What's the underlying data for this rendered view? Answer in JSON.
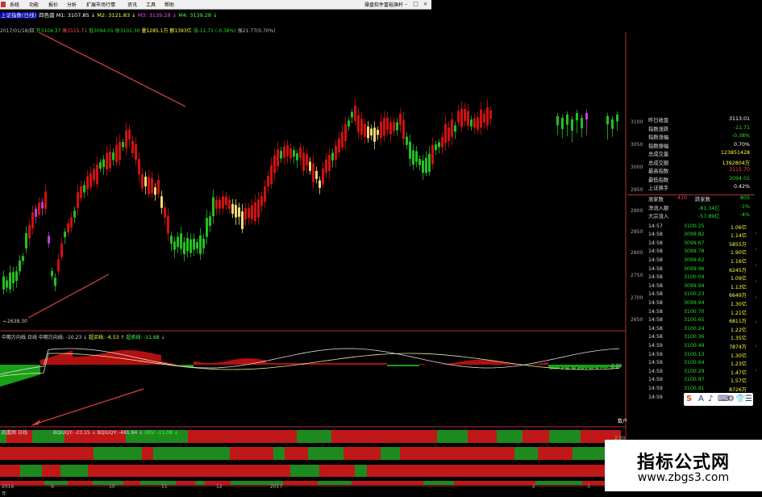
{
  "menubar": {
    "items": [
      "系统",
      "功能",
      "报价",
      "分析",
      "扩展市场行情",
      "资讯",
      "工具",
      "帮助"
    ],
    "right_title": "操盘软件富裕旗杆"
  },
  "chart_header": {
    "title": "上证指数(日线)",
    "mode": "四色谱",
    "m1": "M1: 3107.85 ↓",
    "m2": "M2: 3121.83 ↓",
    "m3": "M3: 3139.28 ↓",
    "m4": "M4: 3139.28 ↓"
  },
  "ohlc_line": {
    "date": "2017/01/18/四",
    "open": "开3104.37",
    "high": "高3115.71",
    "low": "低3094.01",
    "close": "收3101.30",
    "volume": "量1285.1万",
    "amount": "额1393亿",
    "change": "涨-11.71",
    "change_pct": "(-0.38%)",
    "amplitude": "振21.77(0.70%)"
  },
  "price_axis": {
    "ticks": [
      "3100",
      "3050",
      "3000",
      "2950",
      "2900",
      "2850",
      "2800",
      "2750",
      "2700",
      "2650"
    ],
    "low_marker": "←2638.30",
    "colors": {
      "up": "#d01010",
      "down": "#22c022",
      "warm": "#f0d878",
      "special": "#c040d0"
    }
  },
  "info_panel": {
    "rows": [
      {
        "label": "昨日收盘",
        "value": "3113.01",
        "color": "#ffffff"
      },
      {
        "label": "指数涨跌",
        "value": "-11.71",
        "color": "#22e022"
      },
      {
        "label": "指数涨幅",
        "value": "-0.38%",
        "color": "#22e022"
      },
      {
        "label": "指数振幅",
        "value": "0.70%",
        "color": "#ffffff"
      },
      {
        "label": "总成交量",
        "value": "123851428",
        "color": "#ffff44"
      },
      {
        "label": "总成交额",
        "value": "1392804万",
        "color": "#ffff44"
      },
      {
        "label": "最高指数",
        "value": "3115.70",
        "color": "#ff4040"
      },
      {
        "label": "最低指数",
        "value": "3094.01",
        "color": "#22e022"
      },
      {
        "label": "上证换手",
        "value": "0.42%",
        "color": "#ffffff"
      }
    ],
    "rise_fall": {
      "rise_label": "涨家数",
      "rise": "410",
      "fall_label": "跌家数",
      "fall": "805"
    },
    "flows": [
      {
        "label": "净流入额",
        "value": "-81.34亿",
        "pct": "-1%"
      },
      {
        "label": "大宗流入",
        "value": "-57.89亿",
        "pct": "-4%"
      }
    ],
    "ticks": [
      {
        "time": "14:57",
        "price": "3100.25",
        "vol": "1.06亿"
      },
      {
        "time": "14:58",
        "price": "3099.82",
        "vol": "1.14亿"
      },
      {
        "time": "14:58",
        "price": "3099.67",
        "vol": "5855万"
      },
      {
        "time": "14:58",
        "price": "3099.78",
        "vol": "1.90亿"
      },
      {
        "time": "14:58",
        "price": "3099.62",
        "vol": "1.16亿"
      },
      {
        "time": "14:58",
        "price": "3099.96",
        "vol": "6245万"
      },
      {
        "time": "14:58",
        "price": "3100.04",
        "vol": "1.09亿"
      },
      {
        "time": "14:58",
        "price": "3099.94",
        "vol": "1.13亿"
      },
      {
        "time": "14:58",
        "price": "3100.23",
        "vol": "6649万"
      },
      {
        "time": "14:58",
        "price": "3099.94",
        "vol": "1.30亿"
      },
      {
        "time": "14:58",
        "price": "3100.70",
        "vol": "1.21亿"
      },
      {
        "time": "14:58",
        "price": "3100.65",
        "vol": "6811万"
      },
      {
        "time": "14:58",
        "price": "3100.24",
        "vol": "1.22亿"
      },
      {
        "time": "14:58",
        "price": "3100.36",
        "vol": "1.35亿"
      },
      {
        "time": "14:59",
        "price": "3100.49",
        "vol": "7874万"
      },
      {
        "time": "14:59",
        "price": "3100.13",
        "vol": "1.30亿"
      },
      {
        "time": "14:59",
        "price": "3100.64",
        "vol": "1.23亿"
      },
      {
        "time": "14:59",
        "price": "3100.29",
        "vol": "1.47亿"
      },
      {
        "time": "14:59",
        "price": "3100.97",
        "vol": "1.57亿"
      },
      {
        "time": "14:59",
        "price": "3100.91",
        "vol": "8726万"
      },
      {
        "time": "14:59",
        "price": "3100.72",
        "vol": "2.09亿"
      }
    ]
  },
  "indicator1": {
    "name": "中期方向线",
    "period": "日线",
    "v1": "中期方向线: -10.23 ↓",
    "v2": "超买线: -6.53 ↑",
    "v3": "超卖线: -11.68 ↓",
    "axis_value": "0.00"
  },
  "indicator2": {
    "name": "四重图",
    "period": "日线",
    "v1": "BQIUQY: -23.15 ↓",
    "v2": "BQIUQY: -481.84 ↓",
    "v3": "XEV: -11.08 ↓",
    "axis_value": "2.00",
    "right_label": "数户"
  },
  "x_axis": {
    "labels": [
      "2016年",
      "9",
      "10",
      "11",
      "12",
      "2017",
      "2",
      "3"
    ]
  },
  "ime": {
    "logo": "S",
    "items": [
      "A",
      "♪",
      "⌨",
      "⚙",
      "👕",
      "☰"
    ]
  },
  "watermark": {
    "title": "指标公式网",
    "url": "www.zbgs3.com"
  }
}
